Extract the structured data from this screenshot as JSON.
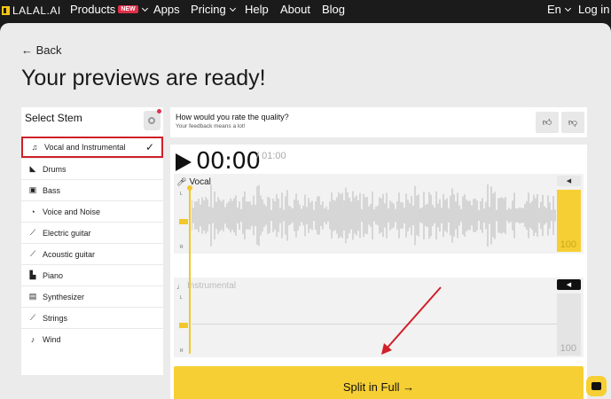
{
  "nav": {
    "logo": "LALAL.AI",
    "items": [
      {
        "label": "Products",
        "badge": "NEW"
      },
      {
        "label": "Apps"
      },
      {
        "label": "Pricing"
      },
      {
        "label": "Help"
      },
      {
        "label": "About"
      },
      {
        "label": "Blog"
      }
    ],
    "language": "En",
    "login": "Log in"
  },
  "back_label": "← Back",
  "page_title": "Your previews are ready!",
  "sidebar": {
    "header": "Select Stem",
    "items": [
      {
        "label": "Vocal and Instrumental",
        "icon": "vocal-instrumental-icon",
        "selected": true
      },
      {
        "label": "Drums",
        "icon": "drums-icon"
      },
      {
        "label": "Bass",
        "icon": "bass-icon"
      },
      {
        "label": "Voice and Noise",
        "icon": "voice-noise-icon"
      },
      {
        "label": "Electric guitar",
        "icon": "electric-guitar-icon"
      },
      {
        "label": "Acoustic guitar",
        "icon": "acoustic-guitar-icon"
      },
      {
        "label": "Piano",
        "icon": "piano-icon"
      },
      {
        "label": "Synthesizer",
        "icon": "synthesizer-icon"
      },
      {
        "label": "Strings",
        "icon": "strings-icon"
      },
      {
        "label": "Wind",
        "icon": "wind-icon"
      }
    ]
  },
  "rating": {
    "question": "How would you rate the quality?",
    "subtitle": "Your feedback means a lot!"
  },
  "player": {
    "current_time": "00:00",
    "duration": "/ 01:00",
    "tracks": [
      {
        "label": "Vocal",
        "volume": "100",
        "channel_left": "L",
        "channel_right": "R"
      },
      {
        "label": "Instrumental",
        "volume": "100",
        "channel_left": "L",
        "channel_right": "R"
      }
    ],
    "split_label": "Split in Full →"
  },
  "colors": {
    "accent": "#f6cf34",
    "selected_outline": "#d0202a",
    "annotation_arrow": "#d0202a"
  }
}
